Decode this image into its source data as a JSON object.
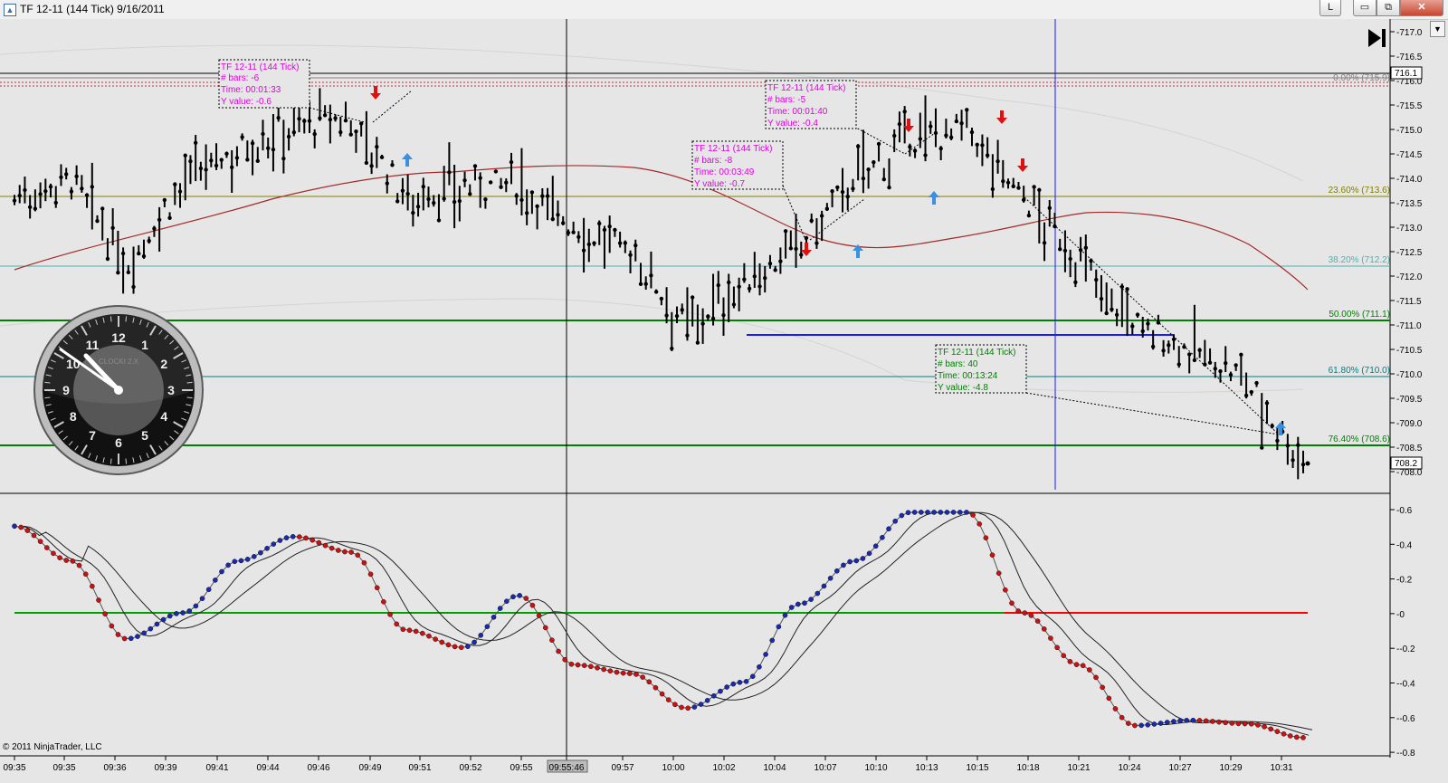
{
  "window": {
    "title": "TF 12-11 (144 Tick)  9/16/2011",
    "btn_l": "L",
    "btn_min": "▭",
    "btn_max": "⧉",
    "btn_close": "✕"
  },
  "colors": {
    "bg": "#e6e6e6",
    "ma_line": "#a52a2a",
    "fib_0": "#808080",
    "fib_236": "#808000",
    "fib_382": "#4fb0b0",
    "fib_50": "#008000",
    "fib_618": "#008080",
    "fib_764": "#008000",
    "down_arrow": "#e01010",
    "up_arrow": "#3a90e0",
    "blue_line": "#1a1aff",
    "osc_red_dot": "#d01010",
    "osc_blue_dot": "#1a2ab0",
    "zero_green": "#00a000",
    "zero_red": "#ff0000"
  },
  "price_axis": {
    "labels": [
      "717.0",
      "716.5",
      "716.0",
      "715.5",
      "715.0",
      "714.5",
      "714.0",
      "713.5",
      "713.0",
      "712.5",
      "712.0",
      "711.5",
      "711.0",
      "710.5",
      "710.0",
      "709.5",
      "709.0",
      "708.5",
      "708.0"
    ],
    "current_high_box": "716.1",
    "current_price_box": "708.2"
  },
  "osc_axis": {
    "labels": [
      "0.6",
      "0.4",
      "0.2",
      "0",
      "-0.2",
      "-0.4",
      "-0.6",
      "-0.8"
    ]
  },
  "fib_levels": [
    {
      "label": "0.00% (715.9)",
      "color": "#808080"
    },
    {
      "label": "23.60% (713.6)",
      "color": "#808000"
    },
    {
      "label": "38.20% (712.2)",
      "color": "#4fb0b0"
    },
    {
      "label": "50.00% (711.1)",
      "color": "#008000"
    },
    {
      "label": "61.80% (710.0)",
      "color": "#008080"
    },
    {
      "label": "76.40% (708.6)",
      "color": "#008000"
    }
  ],
  "annotations": [
    {
      "line1": "TF 12-11 (144 Tick)",
      "line2": "# bars:   -6",
      "line3": "Time:     00:01:33",
      "line4": "Y value:  -0.6",
      "color": "#e000e0"
    },
    {
      "line1": "TF 12-11 (144 Tick)",
      "line2": "# bars:   -5",
      "line3": "Time:     00:01:40",
      "line4": "Y value:  -0.4",
      "color": "#e000e0"
    },
    {
      "line1": "TF 12-11 (144 Tick)",
      "line2": "# bars:   -8",
      "line3": "Time:     00:03:49",
      "line4": "Y value:  -0.7",
      "color": "#e000e0"
    },
    {
      "line1": "TF 12-11 (144 Tick)",
      "line2": "# bars:   40",
      "line3": "Time:     00:13:24",
      "line4": "Y value:  -4.8",
      "color": "#008000"
    }
  ],
  "time_axis": {
    "labels": [
      "09:35",
      "09:35",
      "09:36",
      "09:39",
      "09:41",
      "09:44",
      "09:46",
      "09:49",
      "09:51",
      "09:52",
      "09:55",
      "09:55:46",
      "09:57",
      "10:00",
      "10:02",
      "10:04",
      "10:07",
      "10:10",
      "10:13",
      "10:15",
      "10:18",
      "10:21",
      "10:24",
      "10:27",
      "10:29",
      "10:31"
    ],
    "highlight": "09:55:46"
  },
  "clock": {
    "brand": "CLOCKI 2.X",
    "numerals": [
      "12",
      "1",
      "2",
      "3",
      "4",
      "5",
      "6",
      "7",
      "8",
      "9",
      "10",
      "11"
    ]
  },
  "copyright": "© 2011 NinjaTrader, LLC",
  "chart_data": {
    "type": "line",
    "title": "TF 12-11 (144 Tick)  9/16/2011",
    "x_label": "",
    "y_label": "",
    "ylim": [
      707.8,
      717.2
    ],
    "series": [
      {
        "name": "",
        "x": [
          "09:35",
          "09:36",
          "09:39",
          "09:41",
          "09:44",
          "09:46",
          "09:49",
          "09:51",
          "09:52",
          "09:55",
          "09:57",
          "10:00",
          "10:02",
          "10:04",
          "10:07",
          "10:10",
          "10:13",
          "10:15",
          "10:18",
          "10:21",
          "10:24",
          "10:27",
          "10:29",
          "10:31"
        ],
        "values": [
          713.6,
          714.0,
          712.2,
          713.9,
          714.6,
          715.1,
          715.2,
          713.6,
          713.8,
          713.9,
          713.0,
          712.5,
          711.0,
          711.8,
          712.6,
          714.0,
          714.8,
          715.0,
          713.6,
          712.3,
          711.0,
          710.5,
          709.8,
          708.2
        ]
      }
    ],
    "oscillator": {
      "ylim": [
        -0.8,
        0.6
      ],
      "x": [
        "09:35",
        "09:36",
        "09:39",
        "09:41",
        "09:44",
        "09:46",
        "09:49",
        "09:51",
        "09:52",
        "09:55",
        "09:57",
        "10:00",
        "10:02",
        "10:04",
        "10:07",
        "10:10",
        "10:13",
        "10:15",
        "10:18",
        "10:21",
        "10:24",
        "10:27",
        "10:29",
        "10:31"
      ],
      "values": [
        0.5,
        0.3,
        -0.15,
        0.0,
        0.3,
        0.44,
        0.35,
        -0.1,
        -0.2,
        0.1,
        -0.3,
        -0.35,
        -0.55,
        -0.4,
        0.05,
        0.3,
        0.58,
        0.58,
        0.0,
        -0.3,
        -0.65,
        -0.62,
        -0.64,
        -0.72
      ]
    },
    "grid": false,
    "legend": "none"
  }
}
